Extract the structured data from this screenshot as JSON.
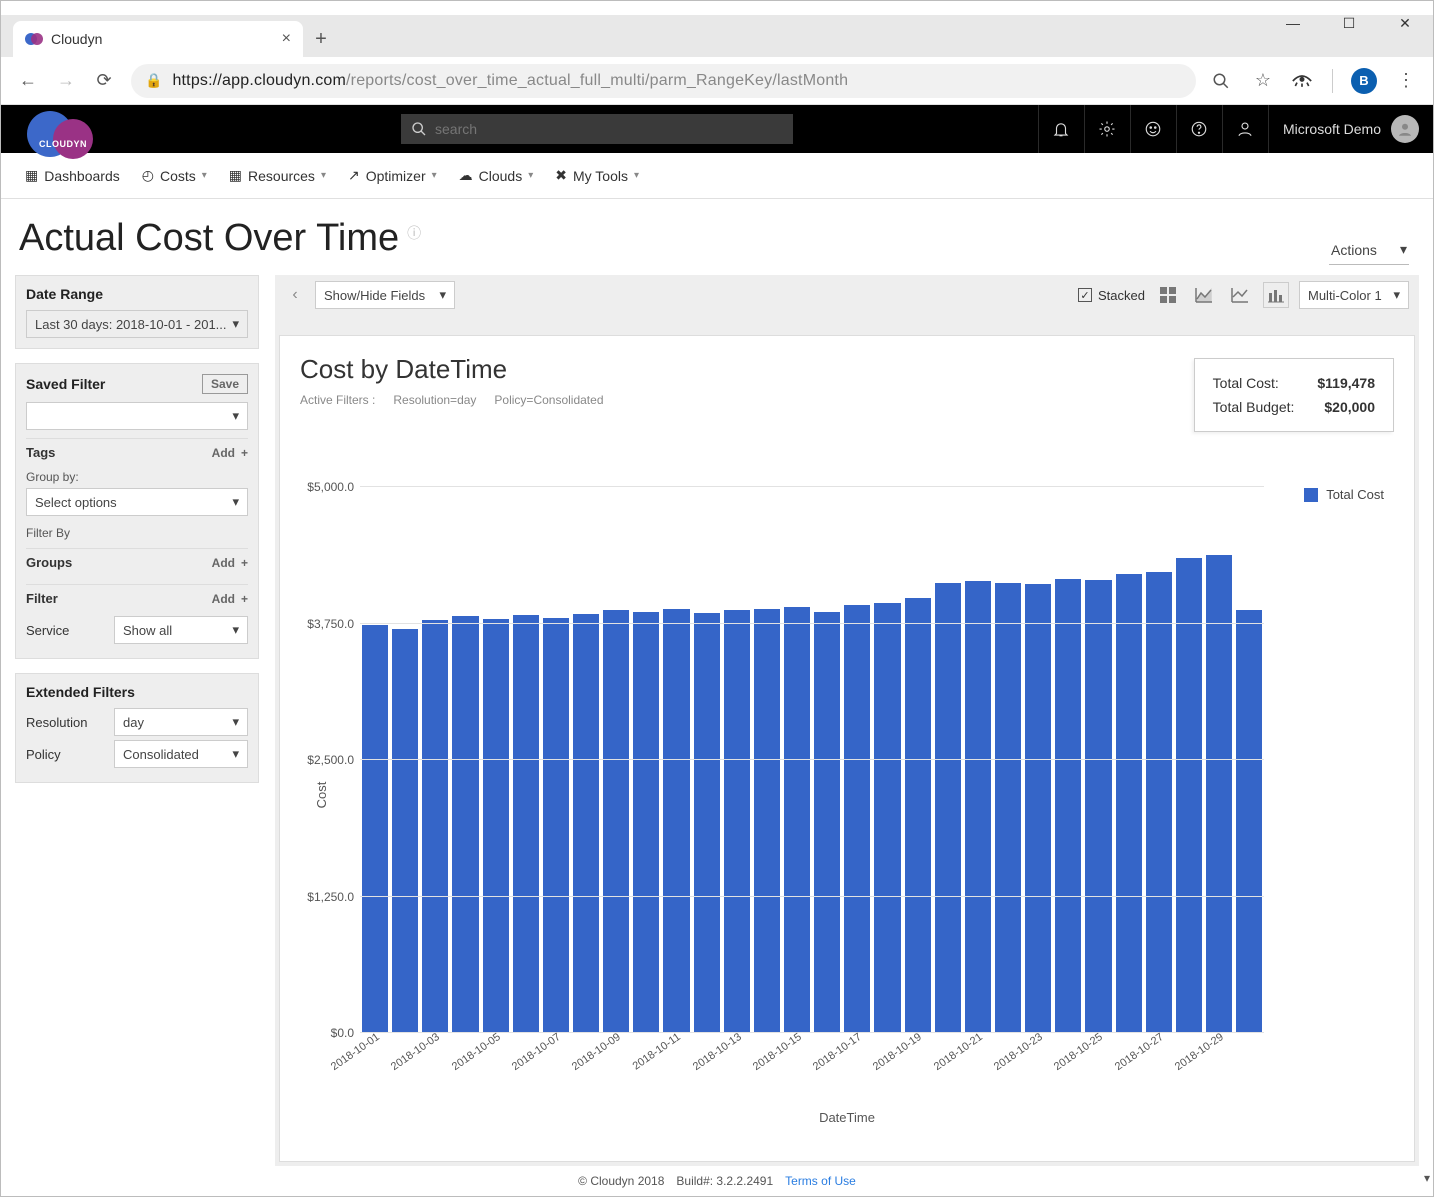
{
  "browser": {
    "tab_title": "Cloudyn",
    "url_host": "https://app.cloudyn.com",
    "url_path": "/reports/cost_over_time_actual_full_multi/parm_RangeKey/lastMonth",
    "avatar_initial": "B"
  },
  "topbar": {
    "search_placeholder": "search",
    "account_label": "Microsoft Demo",
    "brand": "CLOUDYN"
  },
  "menu": {
    "dashboards": "Dashboards",
    "costs": "Costs",
    "resources": "Resources",
    "optimizer": "Optimizer",
    "clouds": "Clouds",
    "mytools": "My Tools"
  },
  "page": {
    "title": "Actual Cost Over Time",
    "actions": "Actions"
  },
  "sidebar": {
    "date_range": {
      "title": "Date Range",
      "value": "Last 30 days:  2018-10-01 - 201..."
    },
    "saved_filter": {
      "title": "Saved Filter",
      "save": "Save"
    },
    "tags": {
      "title": "Tags",
      "add": "Add",
      "groupby_label": "Group by:",
      "groupby_value": "Select options",
      "filterby_label": "Filter By"
    },
    "groups": {
      "title": "Groups",
      "add": "Add"
    },
    "filter": {
      "title": "Filter",
      "add": "Add",
      "service_label": "Service",
      "service_value": "Show all"
    },
    "ext": {
      "title": "Extended Filters",
      "resolution_label": "Resolution",
      "resolution_value": "day",
      "policy_label": "Policy",
      "policy_value": "Consolidated"
    }
  },
  "toolbar": {
    "showhide": "Show/Hide Fields",
    "stacked": "Stacked",
    "colorscheme": "Multi-Color 1"
  },
  "chart_header": {
    "title": "Cost by DateTime",
    "active_filters_label": "Active Filters :",
    "filter1": "Resolution=day",
    "filter2": "Policy=Consolidated"
  },
  "totals": {
    "cost_label": "Total Cost:",
    "cost_value": "$119,478",
    "budget_label": "Total Budget:",
    "budget_value": "$20,000"
  },
  "footer": {
    "copyright": "© Cloudyn 2018",
    "build": "Build#: 3.2.2.2491",
    "terms": "Terms of Use"
  },
  "chart_data": {
    "type": "bar",
    "title": "Cost by DateTime",
    "xlabel": "DateTime",
    "ylabel": "Cost",
    "ylim": [
      0,
      5000
    ],
    "yticks": [
      0,
      1250,
      2500,
      3750,
      5000
    ],
    "ytick_labels": [
      "$0.0",
      "$1,250.0",
      "$2,500.0",
      "$3,750.0",
      "$5,000.0"
    ],
    "legend": [
      "Total Cost"
    ],
    "x_tick_labels": [
      "2018-10-01",
      "2018-10-03",
      "2018-10-05",
      "2018-10-07",
      "2018-10-09",
      "2018-10-11",
      "2018-10-13",
      "2018-10-15",
      "2018-10-17",
      "2018-10-19",
      "2018-10-21",
      "2018-10-23",
      "2018-10-25",
      "2018-10-27",
      "2018-10-29"
    ],
    "categories": [
      "2018-10-01",
      "2018-10-02",
      "2018-10-03",
      "2018-10-04",
      "2018-10-05",
      "2018-10-06",
      "2018-10-07",
      "2018-10-08",
      "2018-10-09",
      "2018-10-10",
      "2018-10-11",
      "2018-10-12",
      "2018-10-13",
      "2018-10-14",
      "2018-10-15",
      "2018-10-16",
      "2018-10-17",
      "2018-10-18",
      "2018-10-19",
      "2018-10-20",
      "2018-10-21",
      "2018-10-22",
      "2018-10-23",
      "2018-10-24",
      "2018-10-25",
      "2018-10-26",
      "2018-10-27",
      "2018-10-28",
      "2018-10-29",
      "2018-10-30"
    ],
    "series": [
      {
        "name": "Total Cost",
        "values": [
          3740,
          3700,
          3780,
          3820,
          3790,
          3830,
          3800,
          3840,
          3870,
          3860,
          3880,
          3850,
          3870,
          3880,
          3900,
          3860,
          3920,
          3940,
          3980,
          4120,
          4140,
          4120,
          4110,
          4160,
          4150,
          4200,
          4220,
          4350,
          4380,
          3870
        ]
      }
    ]
  }
}
